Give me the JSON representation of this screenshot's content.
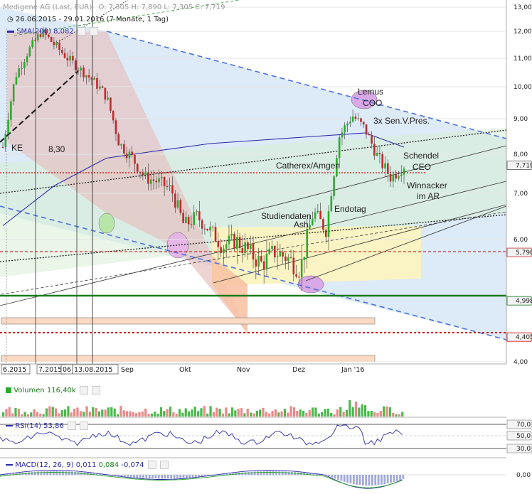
{
  "header": {
    "instrument": "Medigene AG (Last, EUR)",
    "ohlc": "O: 7,305  H: 7,890  L: 7,305  C: 7,719",
    "range": "26.06.2015 - 29.01.2016 (7 Monate, 1 Tag)",
    "sma_label": "SMA(200)",
    "sma_value": "8,082"
  },
  "colors": {
    "up": "#2bab2b",
    "down": "#c0282d",
    "sma": "#2b2ba8",
    "green_line": "#1a7a1a",
    "red_dotted": "#d40000",
    "blue_dashed": "#4d72e0"
  },
  "chart_data": {
    "type": "line",
    "title": "Medigene AG (Last, EUR)",
    "xlabel": "",
    "ylabel": "",
    "ylim": [
      3.9,
      13.1
    ],
    "y_ticks": [
      "13,00",
      "12,00",
      "11,00",
      "10,00",
      "9,00",
      "8,00",
      "7,00",
      "6,00",
      "4,00"
    ],
    "x_ticks": [
      "6.2015",
      "7.2015",
      "06",
      "13.08.2015",
      "Sep",
      "Okt",
      "Nov",
      "Dez",
      "Jan '16"
    ],
    "price_tags": [
      "7,719",
      "5,790",
      "4,998",
      "4,405"
    ],
    "annotations": [
      "KE",
      "8,30",
      "Lemus",
      "COO",
      "3x Sen.V.Pres.",
      "Schendel",
      "CEO",
      "Catherex/Amgen",
      "Winnacker",
      "im AR",
      "Endotag",
      "Studiendaten",
      "Ash"
    ],
    "series": [
      {
        "name": "Medigene AG",
        "x": [
          "2015-06-26",
          "2015-07-03",
          "2015-07-10",
          "2015-07-17",
          "2015-07-24",
          "2015-07-31",
          "2015-08-07",
          "2015-08-14",
          "2015-08-21",
          "2015-08-28",
          "2015-09-04",
          "2015-09-11",
          "2015-09-18",
          "2015-09-25",
          "2015-10-02",
          "2015-10-09",
          "2015-10-16",
          "2015-10-23",
          "2015-10-30",
          "2015-11-06",
          "2015-11-13",
          "2015-11-20",
          "2015-11-27",
          "2015-12-04",
          "2015-12-11",
          "2015-12-18",
          "2015-12-23",
          "2015-12-30",
          "2016-01-08",
          "2016-01-15",
          "2016-01-22",
          "2016-01-29"
        ],
        "values": [
          8.2,
          10.4,
          11.3,
          12.0,
          11.5,
          11.0,
          10.6,
          10.2,
          9.7,
          8.3,
          7.9,
          7.4,
          7.3,
          7.1,
          6.3,
          6.5,
          6.2,
          5.9,
          6.0,
          5.8,
          5.6,
          5.8,
          5.7,
          5.5,
          6.6,
          6.2,
          8.5,
          9.1,
          8.7,
          7.9,
          7.4,
          7.719
        ]
      },
      {
        "name": "SMA(200)",
        "x": [
          "2015-06-26",
          "2015-07-24",
          "2015-08-21",
          "2015-09-18",
          "2015-10-16",
          "2015-11-13",
          "2015-12-11",
          "2016-01-08",
          "2016-01-29"
        ],
        "values": [
          6.3,
          7.2,
          7.9,
          8.1,
          8.3,
          8.4,
          8.5,
          8.6,
          8.2
        ]
      }
    ],
    "panels": [
      {
        "name": "Volumen",
        "label": "Volumen",
        "value": "116,40k"
      },
      {
        "name": "RSI(14)",
        "label": "RSI(14)",
        "value": "53,86",
        "levels": [
          "70,00",
          "50,00",
          "30,00"
        ],
        "axis_labels": [
          "70,0",
          "50,0",
          "30,0"
        ]
      },
      {
        "name": "MACD(12, 26, 9)",
        "label": "MACD(12, 26, 9)",
        "values": [
          "0,011",
          "0,084",
          "-0,074"
        ],
        "axis_label": "0,00"
      }
    ],
    "grid": true,
    "legend": "top-left"
  }
}
